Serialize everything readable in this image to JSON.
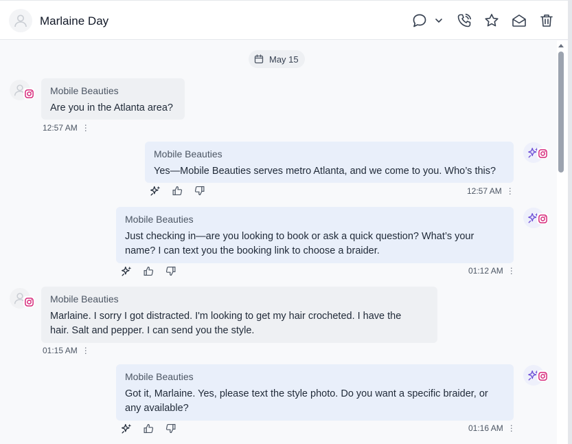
{
  "header": {
    "contact_name": "Marlaine Day"
  },
  "thread": {
    "date_chip": "May 15",
    "messages": [
      {
        "direction": "incoming",
        "sender": "Mobile Beauties",
        "lines": [
          "Are you in the Atlanta area?"
        ],
        "time": "12:57 AM"
      },
      {
        "direction": "outgoing",
        "sender": "Mobile Beauties",
        "lines": [
          "Yes—Mobile Beauties serves metro Atlanta, and we come to you. Who’s this?"
        ],
        "time": "12:57 AM"
      },
      {
        "direction": "outgoing",
        "sender": "Mobile Beauties",
        "lines": [
          "Just checking in—are you looking to book or ask a quick question? What’s your",
          "name? I can text you the booking link to choose a braider."
        ],
        "time": "01:12 AM"
      },
      {
        "direction": "incoming",
        "sender": "Mobile Beauties",
        "lines": [
          "Marlaine. I sorry I got distracted. I'm looking to get my hair crocheted. I have the",
          "hair. Salt and pepper. I can send you the style."
        ],
        "time": "01:15 AM"
      },
      {
        "direction": "outgoing",
        "sender": "Mobile Beauties",
        "lines": [
          "Got it, Marlaine. Yes, please text the style photo. Do you want a specific braider, or",
          "any available?"
        ],
        "time": "01:16 AM"
      }
    ]
  },
  "icons": {
    "header": [
      "user-avatar-icon",
      "comment-icon",
      "chevron-down-icon",
      "phone-icon",
      "star-icon",
      "mail-open-icon",
      "trash-icon"
    ],
    "message": [
      "instagram-icon",
      "ai-sparkle-icon",
      "thumbs-up-icon",
      "thumbs-down-icon",
      "more-vertical-icon"
    ]
  },
  "colors": {
    "instagram": "#d6287a",
    "ai_accent": "#6d4fd6",
    "incoming_bubble": "#eef0f3",
    "outgoing_bubble": "#e9effa"
  }
}
